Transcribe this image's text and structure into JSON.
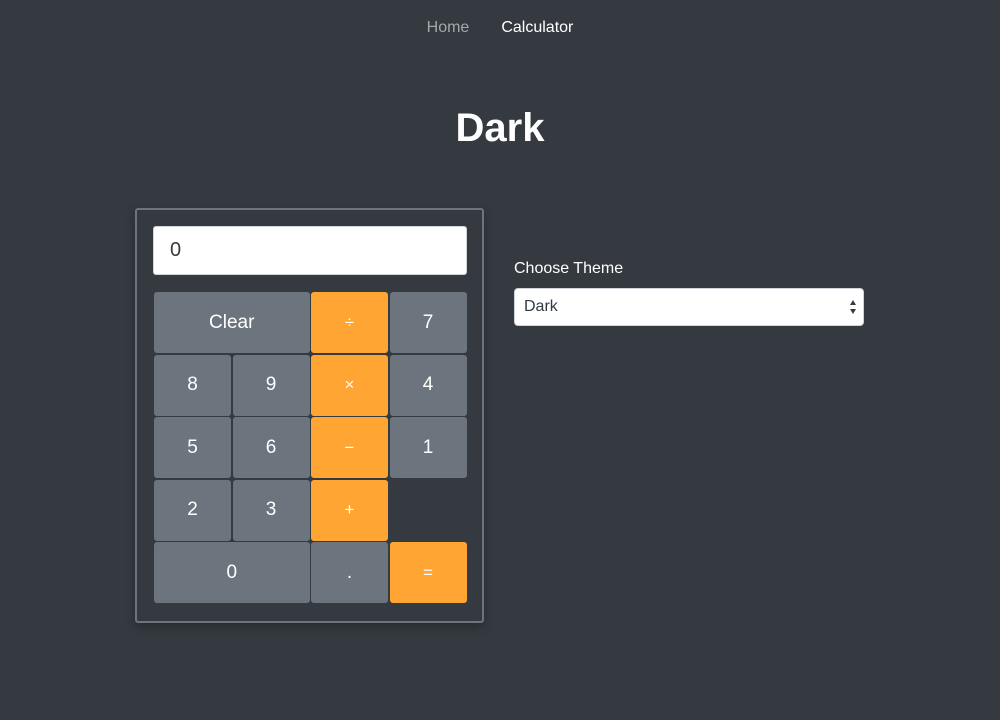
{
  "nav": {
    "items": [
      {
        "label": "Home",
        "active": false
      },
      {
        "label": "Calculator",
        "active": true
      }
    ]
  },
  "page_title": "Dark",
  "calculator": {
    "display_value": "0",
    "keys": {
      "clear": "Clear",
      "divide": "÷",
      "seven": "7",
      "eight": "8",
      "nine": "9",
      "multiply": "×",
      "four": "4",
      "five": "5",
      "six": "6",
      "subtract": "−",
      "one": "1",
      "two": "2",
      "three": "3",
      "add": "+",
      "zero": "0",
      "decimal": ".",
      "equals": "="
    }
  },
  "theme": {
    "label": "Choose Theme",
    "selected": "Dark"
  },
  "colors": {
    "background": "#343a40",
    "key": "#6c757d",
    "operator": "#ffa534",
    "text": "#ffffff"
  },
  "icons": {
    "select_arrows": "up-down-arrows-icon"
  }
}
